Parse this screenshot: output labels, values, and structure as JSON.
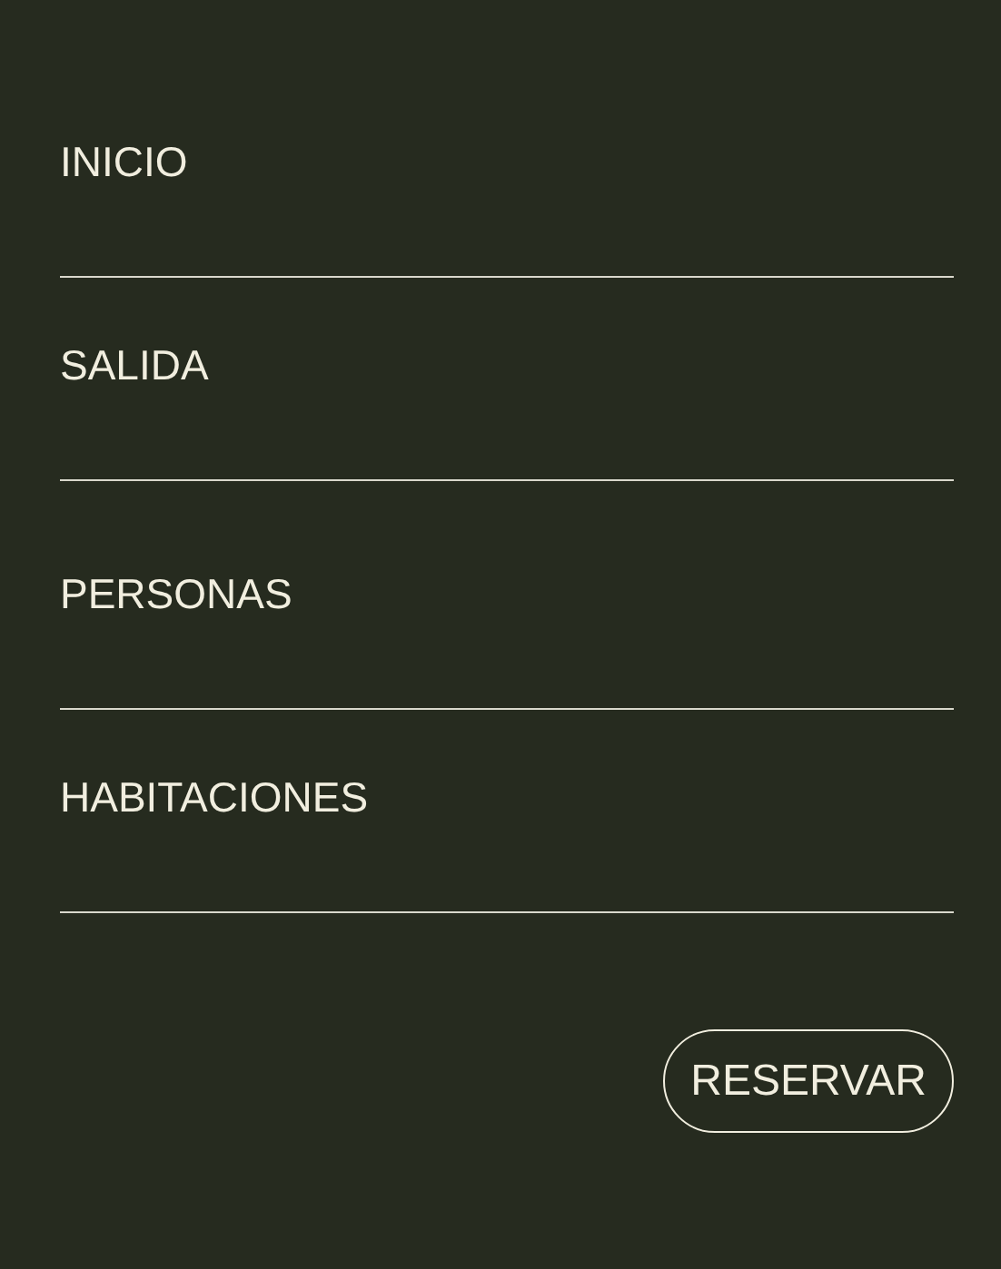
{
  "fields": [
    {
      "placeholder": "INICIO"
    },
    {
      "placeholder": "SALIDA"
    },
    {
      "placeholder": "PERSONAS"
    },
    {
      "placeholder": "HABITACIONES"
    }
  ],
  "button": {
    "label": "RESERVAR"
  }
}
